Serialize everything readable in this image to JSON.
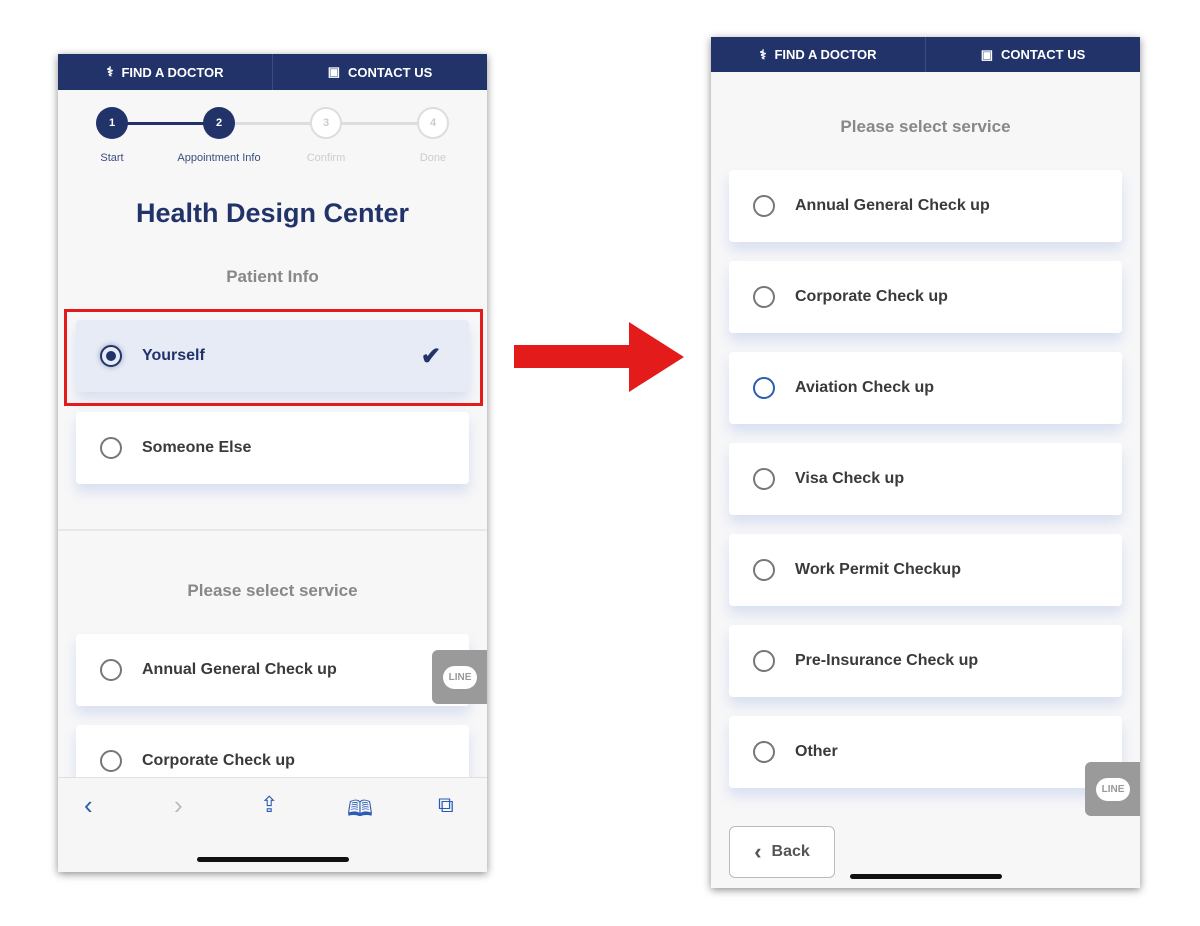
{
  "header": {
    "find_doctor": "FIND A DOCTOR",
    "contact_us": "CONTACT US"
  },
  "stepper": [
    {
      "num": "1",
      "label": "Start",
      "state": "done"
    },
    {
      "num": "2",
      "label": "Appointment Info",
      "state": "active"
    },
    {
      "num": "3",
      "label": "Confirm",
      "state": "pending"
    },
    {
      "num": "4",
      "label": "Done",
      "state": "pending"
    }
  ],
  "title": "Health Design Center",
  "patient_info": {
    "heading": "Patient Info",
    "options": [
      {
        "label": "Yourself",
        "selected": true
      },
      {
        "label": "Someone Else",
        "selected": false
      }
    ]
  },
  "service": {
    "heading": "Please select service",
    "options": [
      "Annual General Check up",
      "Corporate Check up",
      "Aviation Check up",
      "Visa Check up",
      "Work Permit Checkup",
      "Pre-Insurance Check up",
      "Other"
    ],
    "focused": "Aviation Check up"
  },
  "line_label": "LINE",
  "back_label": "Back",
  "colors": {
    "navy": "#22336a",
    "highlight": "#e31b1b",
    "accent": "#2a5bb5"
  }
}
